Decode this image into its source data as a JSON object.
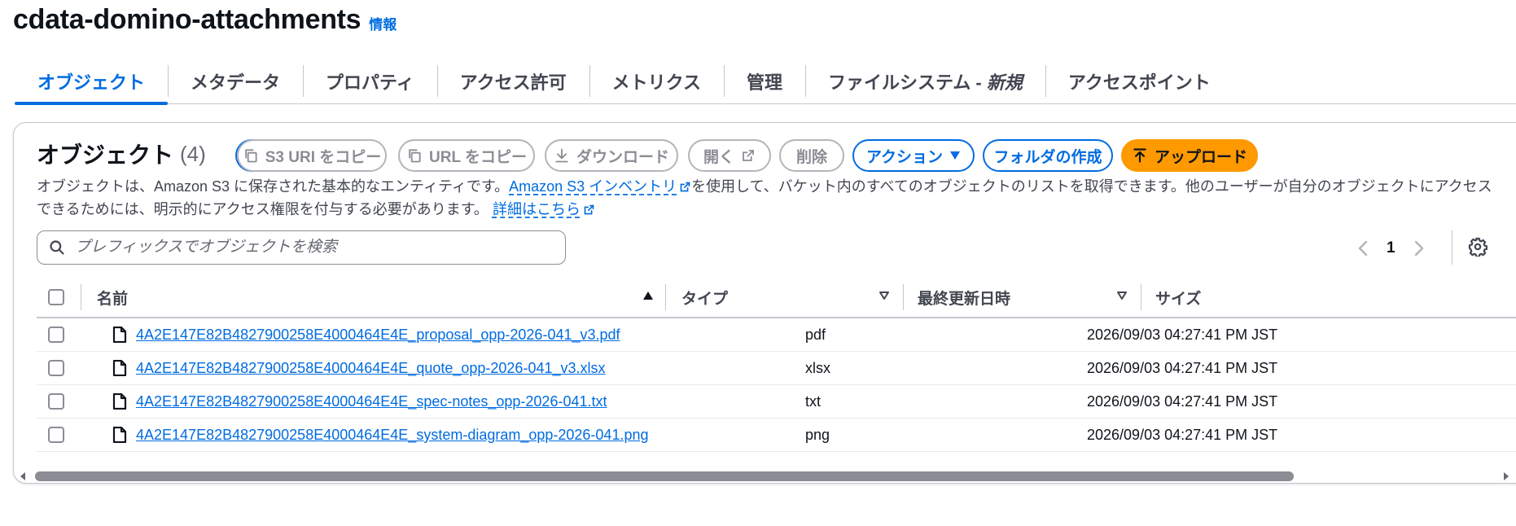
{
  "page": {
    "title": "cdata-domino-attachments",
    "info_link": "情報"
  },
  "tabs": [
    {
      "label": "オブジェクト",
      "active": true
    },
    {
      "label": "メタデータ"
    },
    {
      "label": "プロパティ"
    },
    {
      "label": "アクセス許可"
    },
    {
      "label": "メトリクス"
    },
    {
      "label": "管理"
    },
    {
      "label": "ファイルシステム - ",
      "badge": "新規"
    },
    {
      "label": "アクセスポイント"
    }
  ],
  "objects": {
    "title": "オブジェクト",
    "count": "(4)",
    "toolbar": {
      "copy_s3_uri": "S3 URI をコピー",
      "copy_url": "URL をコピー",
      "download": "ダウンロード",
      "open": "開く",
      "delete": "削除",
      "actions": "アクション",
      "create_folder": "フォルダの作成",
      "upload": "アップロード"
    },
    "description": {
      "part1": "オブジェクトは、Amazon S3 に保存された基本的なエンティティです。",
      "inventory_link": "Amazon S3 インベントリ",
      "part2": "を使用して、バケット内のすべてのオブジェクトのリストを取得できます。他のユーザーが自分のオブジェクトにアクセスできるためには、明示的にアクセス権限を付与する必要があります。",
      "learn_more_link": "詳細はこちら"
    },
    "search": {
      "placeholder": "プレフィックスでオブジェクトを検索",
      "value": ""
    },
    "pagination": {
      "current_page": "1"
    },
    "table": {
      "columns": [
        "名前",
        "タイプ",
        "最終更新日時",
        "サイズ"
      ],
      "rows": [
        {
          "name": "4A2E147E82B4827900258E4000464E4E_proposal_opp-2026-041_v3.pdf",
          "type": "pdf",
          "last_modified": "2026/09/03 04:27:41 PM JST",
          "size": ""
        },
        {
          "name": "4A2E147E82B4827900258E4000464E4E_quote_opp-2026-041_v3.xlsx",
          "type": "xlsx",
          "last_modified": "2026/09/03 04:27:41 PM JST",
          "size": ""
        },
        {
          "name": "4A2E147E82B4827900258E4000464E4E_spec-notes_opp-2026-041.txt",
          "type": "txt",
          "last_modified": "2026/09/03 04:27:41 PM JST",
          "size": ""
        },
        {
          "name": "4A2E147E82B4827900258E4000464E4E_system-diagram_opp-2026-041.png",
          "type": "png",
          "last_modified": "2026/09/03 04:27:41 PM JST",
          "size": ""
        }
      ]
    }
  },
  "colors": {
    "accent": "#006ce0",
    "primary_button": "#ff9900",
    "disabled": "#8c8c94",
    "text": "#0f141a"
  },
  "icons": [
    "refresh-icon",
    "copy-icon",
    "download-icon",
    "external-link-icon",
    "caret-down-icon",
    "upload-icon",
    "search-icon",
    "chevron-left-icon",
    "chevron-right-icon",
    "settings-gear-icon",
    "sort-ascending-icon",
    "sort-icon",
    "file-icon"
  ]
}
